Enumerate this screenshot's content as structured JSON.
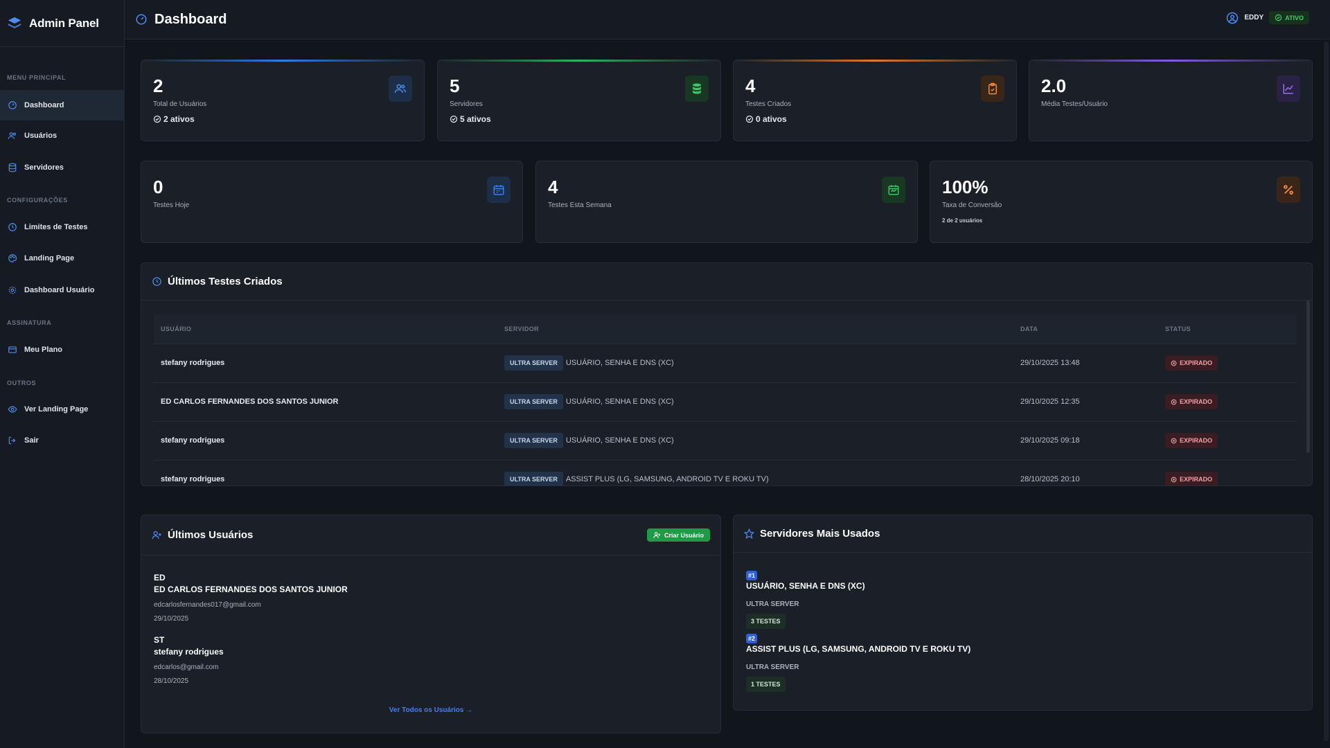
{
  "brand": {
    "name": "Admin Panel"
  },
  "sidebar": {
    "sections": [
      {
        "title": "MENU PRINCIPAL"
      },
      {
        "title": "CONFIGURAÇÕES"
      },
      {
        "title": "ASSINATURA"
      },
      {
        "title": "OUTROS"
      }
    ],
    "items": [
      {
        "label": "Dashboard",
        "icon": "gauge-icon",
        "active": true
      },
      {
        "label": "Usuários",
        "icon": "users-icon"
      },
      {
        "label": "Servidores",
        "icon": "database-icon"
      },
      {
        "label": "Limites de Testes",
        "icon": "clock-icon"
      },
      {
        "label": "Landing Page",
        "icon": "palette-icon"
      },
      {
        "label": "Dashboard Usuário",
        "icon": "settings-icon"
      },
      {
        "label": "Meu Plano",
        "icon": "card-icon"
      },
      {
        "label": "Ver Landing Page",
        "icon": "eye-icon"
      },
      {
        "label": "Sair",
        "icon": "logout-icon"
      }
    ]
  },
  "header": {
    "title": "Dashboard",
    "user": "EDDY",
    "status": "ATIVO"
  },
  "stats_row1": [
    {
      "value": "2",
      "label": "Total de Usuários",
      "sub": "2 ativos",
      "accent": "#2f7de1",
      "icon": "users-icon",
      "icon_color": "#4c8df0",
      "icon_bg": "#1d2e48"
    },
    {
      "value": "5",
      "label": "Servidores",
      "sub": "5 ativos",
      "accent": "#2fb35a",
      "icon": "database-icon",
      "icon_color": "#3cc466",
      "icon_bg": "#183824"
    },
    {
      "value": "4",
      "label": "Testes Criados",
      "sub": "0 ativos",
      "accent": "#e07a2a",
      "icon": "clipboard-icon",
      "icon_color": "#f08a3a",
      "icon_bg": "#3a2618"
    },
    {
      "value": "2.0",
      "label": "Média Testes/Usuário",
      "sub": "",
      "accent": "#8a5be0",
      "icon": "chart-icon",
      "icon_color": "#9a6cf0",
      "icon_bg": "#2a2244"
    }
  ],
  "stats_row2": [
    {
      "value": "0",
      "label": "Testes Hoje",
      "icon": "calendar-icon",
      "icon_color": "#3d7bf0",
      "icon_bg": "#1d2e48"
    },
    {
      "value": "4",
      "label": "Testes Esta Semana",
      "icon": "calendar-week-icon",
      "icon_color": "#3cc466",
      "icon_bg": "#183824"
    },
    {
      "value": "100%",
      "label": "Taxa de Conversão",
      "sub": "2 de 2 usuários",
      "icon": "percent-icon",
      "icon_color": "#f08a3a",
      "icon_bg": "#3a2618"
    }
  ],
  "tests_panel": {
    "title": "Últimos Testes Criados",
    "columns": [
      "USUÁRIO",
      "SERVIDOR",
      "DATA",
      "STATUS"
    ],
    "rows": [
      {
        "user": "stefany rodrigues",
        "server_tag": "ULTRA SERVER",
        "server": "USUÁRIO, SENHA E DNS (XC)",
        "date": "29/10/2025 13:48",
        "status": "EXPIRADO"
      },
      {
        "user": "ED CARLOS FERNANDES DOS SANTOS JUNIOR",
        "server_tag": "ULTRA SERVER",
        "server": "USUÁRIO, SENHA E DNS (XC)",
        "date": "29/10/2025 12:35",
        "status": "EXPIRADO"
      },
      {
        "user": "stefany rodrigues",
        "server_tag": "ULTRA SERVER",
        "server": "USUÁRIO, SENHA E DNS (XC)",
        "date": "29/10/2025 09:18",
        "status": "EXPIRADO"
      },
      {
        "user": "stefany rodrigues",
        "server_tag": "ULTRA SERVER",
        "server": "ASSIST PLUS (LG, SAMSUNG, ANDROID TV E ROKU TV)",
        "date": "28/10/2025 20:10",
        "status": "EXPIRADO"
      }
    ]
  },
  "users_panel": {
    "title": "Últimos Usuários",
    "create_label": "Criar Usuário",
    "users": [
      {
        "initials": "ED",
        "name": "ED CARLOS FERNANDES DOS SANTOS JUNIOR",
        "email": "edcarlosfernandes017@gmail.com",
        "date": "29/10/2025"
      },
      {
        "initials": "ST",
        "name": "stefany rodrigues",
        "email": "edcarlos@gmail.com",
        "date": "28/10/2025"
      }
    ],
    "view_all": "Ver Todos os Usuários →"
  },
  "servers_panel": {
    "title": "Servidores Mais Usados",
    "servers": [
      {
        "rank": "#1",
        "name": "USUÁRIO, SENHA E DNS (XC)",
        "group": "ULTRA SERVER",
        "tests": "3 TESTES"
      },
      {
        "rank": "#2",
        "name": "ASSIST PLUS (LG, SAMSUNG, ANDROID TV E ROKU TV)",
        "group": "ULTRA SERVER",
        "tests": "1 TESTES"
      }
    ]
  }
}
